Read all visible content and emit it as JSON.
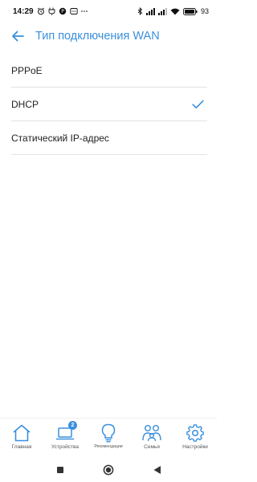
{
  "status_bar": {
    "time": "14:29",
    "battery_percent": "93"
  },
  "header": {
    "back_icon": "arrow-left-icon",
    "title": "Тип подключения WAN"
  },
  "options": [
    {
      "label": "PPPoE",
      "selected": false
    },
    {
      "label": "DHCP",
      "selected": true
    },
    {
      "label": "Статический IP-адрес",
      "selected": false
    }
  ],
  "bottom_nav": {
    "items": [
      {
        "label": "Главная",
        "icon": "home-icon"
      },
      {
        "label": "Устройства",
        "icon": "laptop-icon",
        "badge": "2"
      },
      {
        "label": "Рекомендации",
        "icon": "lightbulb-icon"
      },
      {
        "label": "Семья",
        "icon": "family-icon"
      },
      {
        "label": "Настройки",
        "icon": "gear-icon"
      }
    ]
  },
  "colors": {
    "accent": "#3a8fdc",
    "text": "#222222",
    "divider": "#e2e2e2"
  }
}
